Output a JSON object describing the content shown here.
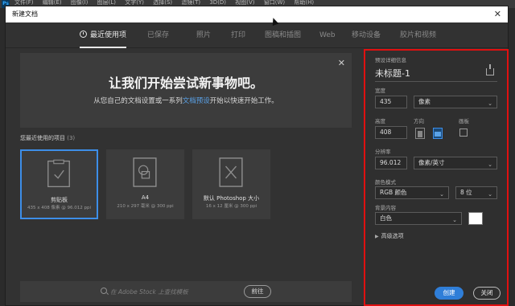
{
  "menubar": {
    "logo": "Ps",
    "items": [
      "文件(F)",
      "编辑(E)",
      "图像(I)",
      "图层(L)",
      "文字(Y)",
      "选择(S)",
      "滤镜(T)",
      "3D(D)",
      "视图(V)",
      "窗口(W)",
      "帮助(H)"
    ]
  },
  "dialog": {
    "title": "新建文档",
    "close_glyph": "✕"
  },
  "tabs": [
    {
      "label": "最近使用项"
    },
    {
      "label": "已保存"
    },
    {
      "label": "照片"
    },
    {
      "label": "打印"
    },
    {
      "label": "图稿和插图"
    },
    {
      "label": "Web"
    },
    {
      "label": "移动设备"
    },
    {
      "label": "胶片和视频"
    }
  ],
  "hero": {
    "title": "让我们开始尝试新事物吧。",
    "text_before": "从您自己的文档设置或一系列",
    "link": "文档预设",
    "text_after": "开始以快速开始工作。",
    "close_glyph": "✕"
  },
  "recent": {
    "heading": "您最近使用的项目",
    "count": "(3)",
    "items": [
      {
        "name": "剪贴板",
        "meta": "435 x 408 像素 @ 96.012 ppi",
        "icon": "clipboard-icon"
      },
      {
        "name": "A4",
        "meta": "210 x 297 毫米 @ 300 ppi",
        "icon": "document-shapes-icon"
      },
      {
        "name": "默认 Photoshop 大小",
        "meta": "16 x 12 厘米 @ 300 ppi",
        "icon": "document-brush-icon"
      }
    ]
  },
  "search": {
    "placeholder": "在 Adobe Stock 上查找模板",
    "go_label": "前往"
  },
  "preset": {
    "section_label": "预设详细信息",
    "name": "未标题-1",
    "width_label": "宽度",
    "width_value": "435",
    "width_unit": "像素",
    "height_label": "高度",
    "height_value": "408",
    "orientation_label": "方向",
    "artboard_label": "画板",
    "resolution_label": "分辨率",
    "resolution_value": "96.012",
    "resolution_unit": "像素/英寸",
    "color_mode_label": "颜色模式",
    "color_mode_value": "RGB 颜色",
    "bit_depth_value": "8 位",
    "background_label": "背景内容",
    "background_value": "白色",
    "background_color": "#ffffff",
    "advanced_label": "高级选项",
    "create_label": "创建",
    "close_label": "关闭",
    "chevron": "⌄",
    "adv_caret": "▶"
  },
  "colors": {
    "accent": "#2f7ed8",
    "highlight_border": "#e01010"
  }
}
